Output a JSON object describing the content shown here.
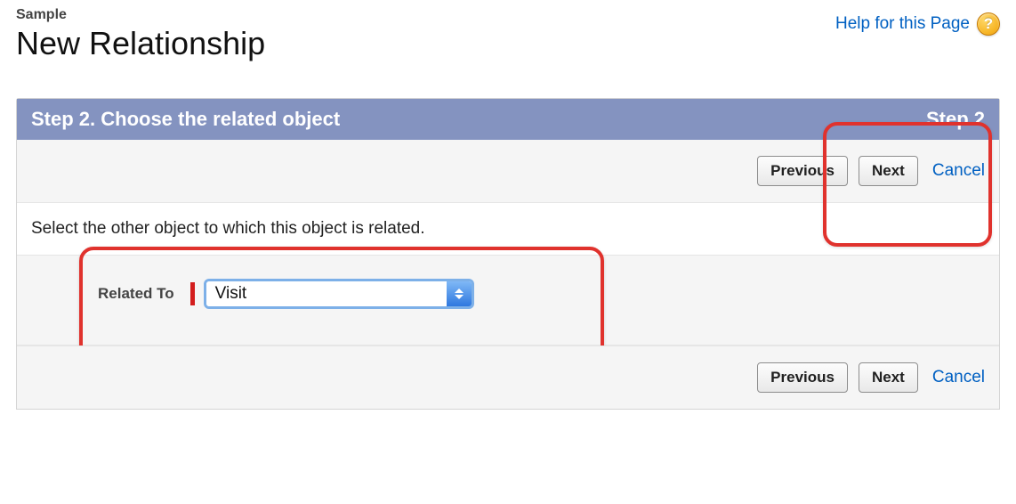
{
  "header": {
    "breadcrumb": "Sample",
    "title": "New Relationship",
    "help_label": "Help for this Page",
    "help_icon_char": "?"
  },
  "wizard": {
    "step_title": "Step 2. Choose the related object",
    "step_indicator": "Step 2",
    "buttons": {
      "previous": "Previous",
      "next": "Next",
      "cancel": "Cancel"
    },
    "instruction": "Select the other object to which this object is related.",
    "field": {
      "label": "Related To",
      "value": "Visit"
    }
  },
  "colors": {
    "header_bg": "#8493c0",
    "link": "#0060c2",
    "highlight": "#e0322d",
    "required": "#d31d1d"
  }
}
